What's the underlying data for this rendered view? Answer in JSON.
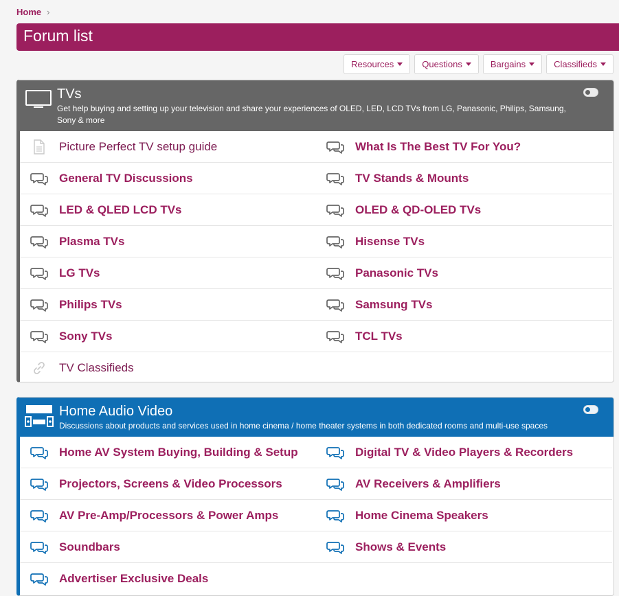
{
  "breadcrumb": {
    "home": "Home",
    "sep": "›"
  },
  "page_title": "Forum list",
  "quick_nav": [
    {
      "label": "Resources"
    },
    {
      "label": "Questions"
    },
    {
      "label": "Bargains"
    },
    {
      "label": "Classifieds"
    }
  ],
  "categories": [
    {
      "title": "TVs",
      "description": "Get help buying and setting up your television and share your experiences of OLED, LED, LCD TVs from LG, Panasonic, Philips, Samsung, Sony & more",
      "accent": "#666666",
      "nodes": [
        {
          "label": "Picture Perfect TV setup guide",
          "icon": "page-icon"
        },
        {
          "label": "What Is The Best TV For You?",
          "icon": "chat-bubbles-icon"
        },
        {
          "label": "General TV Discussions",
          "icon": "chat-bubbles-icon"
        },
        {
          "label": "TV Stands & Mounts",
          "icon": "chat-bubbles-icon"
        },
        {
          "label": "LED & QLED LCD TVs",
          "icon": "chat-bubbles-icon"
        },
        {
          "label": "OLED & QD-OLED TVs",
          "icon": "chat-bubbles-icon"
        },
        {
          "label": "Plasma TVs",
          "icon": "chat-bubbles-icon"
        },
        {
          "label": "Hisense TVs",
          "icon": "chat-bubbles-icon"
        },
        {
          "label": "LG TVs",
          "icon": "chat-bubbles-icon"
        },
        {
          "label": "Panasonic TVs",
          "icon": "chat-bubbles-icon"
        },
        {
          "label": "Philips TVs",
          "icon": "chat-bubbles-icon"
        },
        {
          "label": "Samsung TVs",
          "icon": "chat-bubbles-icon"
        },
        {
          "label": "Sony TVs",
          "icon": "chat-bubbles-icon"
        },
        {
          "label": "TCL TVs",
          "icon": "chat-bubbles-icon"
        },
        {
          "label": "TV Classifieds",
          "icon": "link-icon"
        }
      ]
    },
    {
      "title": "Home Audio Video",
      "description": "Discussions about products and services used in home cinema / home theater systems in both dedicated rooms and multi-use spaces",
      "accent": "#0f6fb5",
      "nodes": [
        {
          "label": "Home AV System Buying, Building & Setup",
          "icon": "chat-bubbles-icon"
        },
        {
          "label": "Digital TV & Video Players & Recorders",
          "icon": "chat-bubbles-icon"
        },
        {
          "label": "Projectors, Screens & Video Processors",
          "icon": "chat-bubbles-icon"
        },
        {
          "label": "AV Receivers & Amplifiers",
          "icon": "chat-bubbles-icon"
        },
        {
          "label": "AV Pre-Amp/Processors & Power Amps",
          "icon": "chat-bubbles-icon"
        },
        {
          "label": "Home Cinema Speakers",
          "icon": "chat-bubbles-icon"
        },
        {
          "label": "Soundbars",
          "icon": "chat-bubbles-icon"
        },
        {
          "label": "Shows & Events",
          "icon": "chat-bubbles-icon"
        },
        {
          "label": "Advertiser Exclusive Deals",
          "icon": "chat-bubbles-icon"
        }
      ]
    }
  ],
  "colors": {
    "brand": "#9c1f5e",
    "tvs_header": "#666666",
    "hav_header": "#0f6fb5"
  }
}
